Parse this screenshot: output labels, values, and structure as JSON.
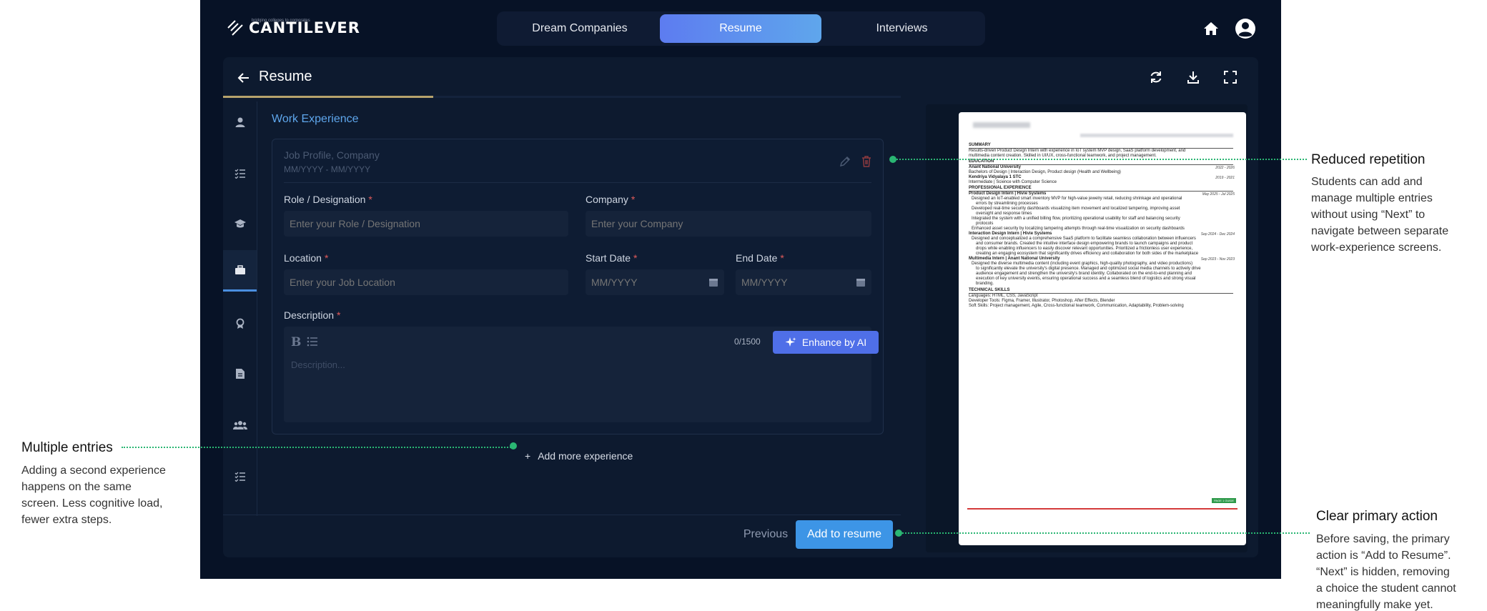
{
  "header": {
    "logo_text": "CANTILEVER",
    "logo_tagline": "bridging colleges to corporates",
    "tabs": [
      {
        "label": "Dream Companies",
        "active": false
      },
      {
        "label": "Resume",
        "active": true
      },
      {
        "label": "Interviews",
        "active": false
      }
    ]
  },
  "panel": {
    "title": "Resume",
    "progress": 0.31,
    "sidebar_icons": [
      "person-icon",
      "list-check-icon",
      "graduation-cap-icon",
      "briefcase-icon",
      "award-icon",
      "document-icon",
      "users-icon",
      "task-list-icon"
    ],
    "active_sidebar": 3
  },
  "form": {
    "section_title": "Work Experience",
    "card_title": "Job Profile,  Company",
    "card_dates": "MM/YYYY  -  MM/YYYY",
    "role_label": "Role / Designation",
    "role_placeholder": "Enter your Role / Designation",
    "company_label": "Company",
    "company_placeholder": "Enter your Company",
    "location_label": "Location",
    "location_placeholder": "Enter your Job Location",
    "start_label": "Start Date",
    "start_placeholder": "MM/YYYY",
    "end_label": "End Date",
    "end_placeholder": "MM/YYYY",
    "desc_label": "Description",
    "required_mark": "*",
    "counter": "0/1500",
    "enhance_label": "Enhance by AI",
    "desc_placeholder": "Description...",
    "add_more": "Add more experience",
    "add_more_icon": "+",
    "prev_label": "Previous",
    "add_label": "Add to resume"
  },
  "resume_preview": {
    "summary_h": "SUMMARY",
    "summary_1": "Results-driven Product Design Intern with experience in IoT system MVP design, SaaS platform development, and",
    "summary_2": "multimedia content creation. Skilled in UI/UX, cross-functional teamwork, and project management.",
    "edu_h": "EDUCATION",
    "edu_1": "Anant National University",
    "edu_1_date": "2022 - 2026",
    "edu_2": "Bachelors of Design | Interaction Design, Product design (Health and Wellbeing)",
    "edu_3": "Kendriya Vidyalaya 1 STC",
    "edu_3_date": "2019 - 2021",
    "edu_4": "Intermediate | Science with Computer Science",
    "exp_h": "PROFESSIONAL EXPERIENCE",
    "exp_1": "Product Design Intern | Hivie Systems",
    "exp_1_date": "May 2025 - Jul 2025",
    "exp_1a": "Designed an IoT-enabled smart inventory MVP for high-value jewelry retail, reducing shrinkage and operational",
    "exp_1b": "errors by streamlining processes",
    "exp_1c": "Developed real-time security dashboards visualizing item movement and localized tampering, improving asset",
    "exp_1d": "oversight and response times",
    "exp_1e": "Integrated the system with a unified billing flow, prioritizing operational usability for staff and balancing security",
    "exp_1f": "protocols",
    "exp_1g": "Enhanced asset security by localizing tampering attempts through real-time visualization on security dashboards",
    "exp_2": "Interaction Design Intern | Hivie Systems",
    "exp_2_date": "Sep 2024 - Dec 2024",
    "exp_2a": "Designed and conceptualized a comprehensive SaaS platform to facilitate seamless collaboration between influencers",
    "exp_2b": "and consumer brands. Created the intuitive interface design empowering brands to launch campaigns and product",
    "exp_2c": "drops while enabling influencers to easily discover relevant opportunities. Prioritized a frictionless user experience,",
    "exp_2d": "creating an engaging ecosystem that significantly drives efficiency and collaboration for both sides of the marketplace",
    "exp_3": "Multimedia Intern | Anant National University",
    "exp_3_date": "Sep 2023 - Nov 2023",
    "exp_3a": "Designed the diverse multimedia content (including event graphics, high-quality photography, and video productions)",
    "exp_3b": "to significantly elevate the university's digital presence. Managed and optimized social media channels to actively drive",
    "exp_3c": "audience engagement and strengthen the university's brand identity. Collaborated on the end-to-end planning and",
    "exp_3d": "execution of key university events, ensuring operational success and a seamless blend of logistics and strong visual",
    "exp_3e": "branding.",
    "skills_h": "TECHNICAL SKILLS",
    "skills_1": "Languages: HTML, CSS, JavaScript",
    "skills_2": "Developer Tools: Figma, Framer, Illustrator, Photoshop, After Effects, Blender",
    "skills_3": "Soft Skills: Project management, Agile, Cross-functional teamwork, Communication, Adaptability, Problem-solving",
    "page_badge": "PAGE 1 GUIDE"
  },
  "annotations": {
    "multi_title": "Multiple entries",
    "multi_body": [
      "Adding a second experience",
      "happens on the same",
      "screen. Less cognitive load,",
      "fewer extra steps."
    ],
    "repeat_title": "Reduced repetition",
    "repeat_body": [
      "Students can add and",
      "manage multiple entries",
      "without using “Next” to",
      "navigate between separate",
      "work-experience screens."
    ],
    "primary_title": "Clear primary action",
    "primary_body": [
      "Before saving, the primary",
      "action is “Add to Resume”.",
      "“Next” is hidden, removing",
      "a choice the student cannot",
      "meaningfully make yet."
    ]
  },
  "colors": {
    "app_bg": "#071226",
    "accent": "#3d95e6",
    "progress": "#b6a36c",
    "annotation": "#2ab673"
  }
}
